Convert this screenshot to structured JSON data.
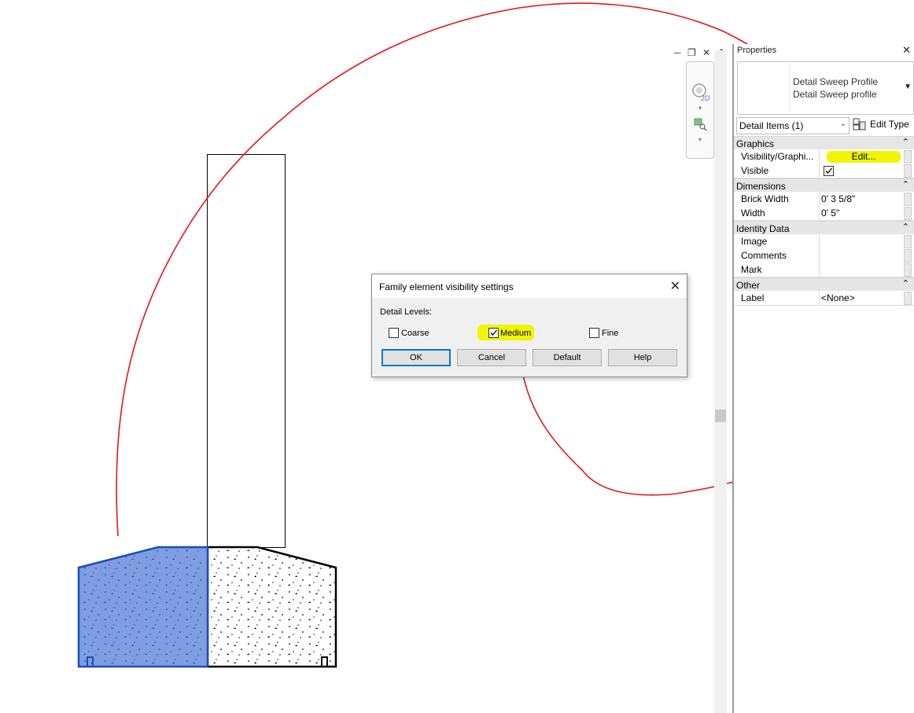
{
  "window_controls": {
    "minimize_icon": "minimize-icon",
    "restore_icon": "restore-icon",
    "close_icon": "close-icon",
    "collapse_icon": "collapse-up-icon"
  },
  "navbar": {
    "zoom_label": "2D"
  },
  "properties": {
    "title": "Properties",
    "close": "✕",
    "type_name_line1": "Detail Sweep Profile",
    "type_name_line2": "Detail Sweep profile",
    "filter_label": "Detail Items (1)",
    "edit_type_label": "Edit Type",
    "groups": {
      "graphics": "Graphics",
      "dimensions": "Dimensions",
      "identity": "Identity Data",
      "other": "Other"
    },
    "rows": {
      "visibility_name": "Visibility/Graphi...",
      "visibility_value": "Edit...",
      "visible_name": "Visible",
      "brick_width_name": "Brick Width",
      "brick_width_value": "0'  3 5/8\"",
      "width_name": "Width",
      "width_value": "0'  5\"",
      "image_name": "Image",
      "comments_name": "Comments",
      "mark_name": "Mark",
      "label_name": "Label",
      "label_value": "<None>"
    },
    "highlight_color": "#f1f500"
  },
  "dialog": {
    "title": "Family element visibility settings",
    "close": "✕",
    "detail_levels_label": "Detail Levels:",
    "coarse_label": "Coarse",
    "medium_label": "Medium",
    "fine_label": "Fine",
    "coarse_checked": false,
    "medium_checked": true,
    "fine_checked": false,
    "ok_label": "OK",
    "cancel_label": "Cancel",
    "default_label": "Default",
    "help_label": "Help"
  },
  "annotation_color": "#e8151b",
  "selection_color": "#1b4fb8"
}
